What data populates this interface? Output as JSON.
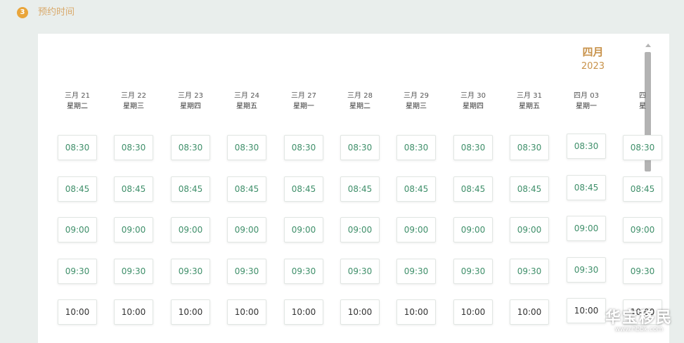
{
  "section": {
    "step": "3",
    "title": "预约时间"
  },
  "calendar": {
    "month": "四月",
    "year": "2023"
  },
  "days": [
    {
      "date": "三月 21",
      "weekday": "星期二"
    },
    {
      "date": "三月 22",
      "weekday": "星期三"
    },
    {
      "date": "三月 23",
      "weekday": "星期四"
    },
    {
      "date": "三月 24",
      "weekday": "星期五"
    },
    {
      "date": "三月 27",
      "weekday": "星期一"
    },
    {
      "date": "三月 28",
      "weekday": "星期二"
    },
    {
      "date": "三月 29",
      "weekday": "星期三"
    },
    {
      "date": "三月 30",
      "weekday": "星期四"
    },
    {
      "date": "三月 31",
      "weekday": "星期五"
    },
    {
      "date": "四月 03",
      "weekday": "星期一"
    },
    {
      "date": "四",
      "weekday": "星"
    }
  ],
  "time_slots": [
    "08:30",
    "08:45",
    "09:00",
    "09:30",
    "10:00"
  ],
  "watermark": {
    "title": "华宝移民",
    "url": "www.hbbk.com"
  }
}
